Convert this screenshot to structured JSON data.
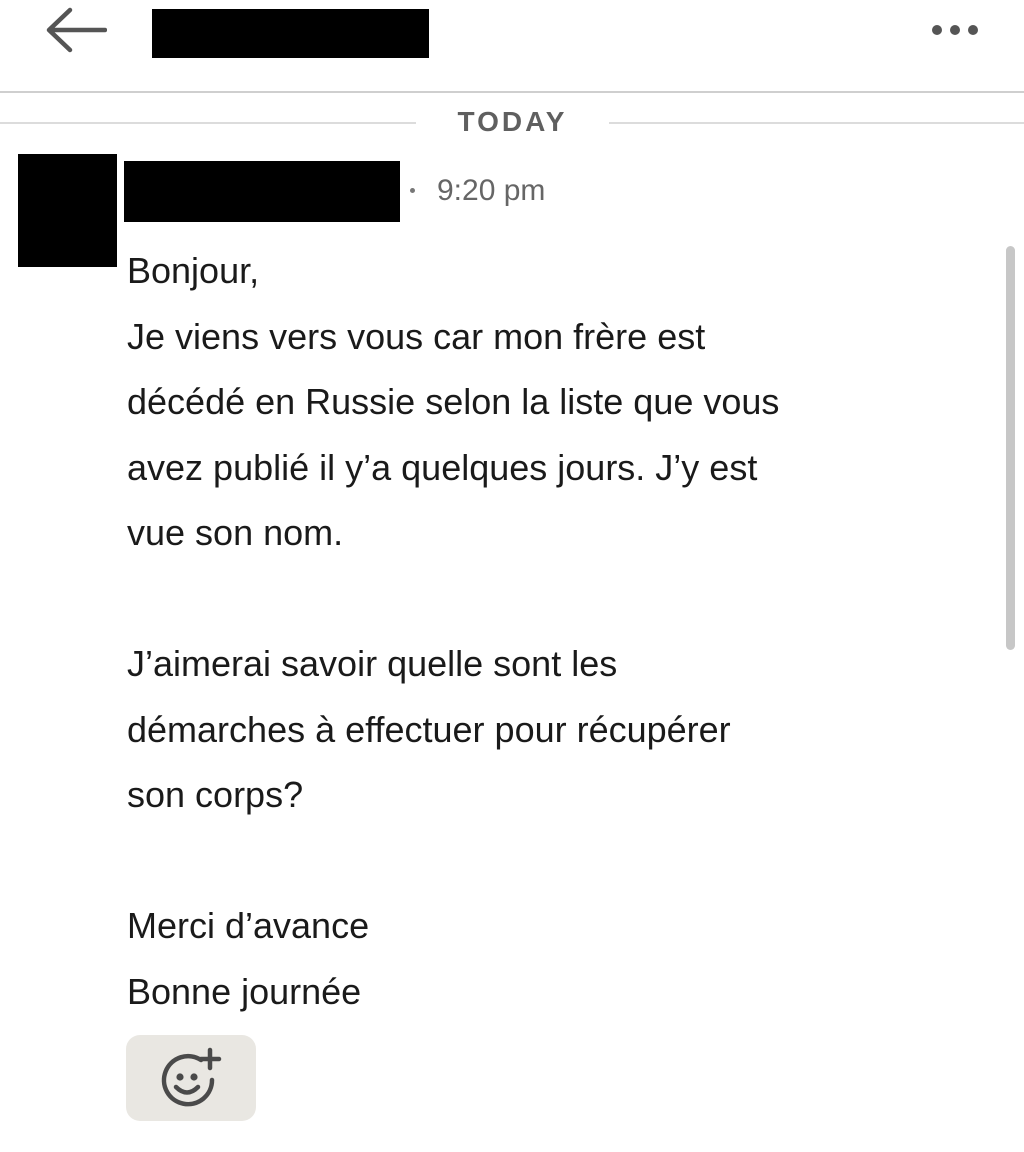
{
  "header": {
    "back_icon": "arrow-left-icon",
    "more_icon": "more-horizontal-icon"
  },
  "date_separator": {
    "label": "TODAY"
  },
  "message": {
    "time": "9:20 pm",
    "lines": [
      "Bonjour,",
      "Je viens vers vous car mon frère est",
      "décédé en Russie selon la liste que vous",
      "avez publié il y’a quelques jours. J’y est",
      "vue son nom.",
      "",
      "J’aimerai savoir quelle sont les",
      "démarches à effectuer pour récupérer",
      "son corps?",
      "",
      "Merci d’avance",
      "Bonne journée"
    ],
    "reaction_icon": "add-reaction-icon"
  },
  "colors": {
    "reaction_bg": "#e9e7e2",
    "meta_text": "#666666",
    "divider": "#cfcfcf"
  }
}
